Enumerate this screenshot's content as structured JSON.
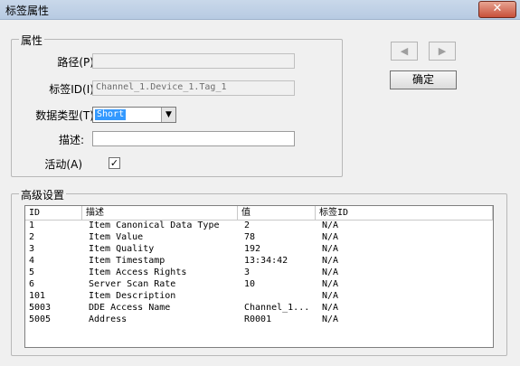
{
  "window": {
    "title": "标签属性",
    "close_glyph": "✕"
  },
  "properties": {
    "group_label": "属性",
    "path": {
      "label": "路径(P):",
      "value": ""
    },
    "tag_id": {
      "label": "标签ID(I):",
      "value": "Channel_1.Device_1.Tag_1"
    },
    "data_type": {
      "label": "数据类型(T):",
      "value": "Short"
    },
    "description": {
      "label": "描述:",
      "value": ""
    },
    "active": {
      "label": "活动(A)",
      "checked": true,
      "glyph": "✓"
    }
  },
  "nav": {
    "prev_glyph": "◀",
    "next_glyph": "▶"
  },
  "ok_button": {
    "label": "确定"
  },
  "advanced": {
    "group_label": "高级设置",
    "columns": [
      "ID",
      "描述",
      "值",
      "标签ID"
    ],
    "rows": [
      {
        "id": "1",
        "desc": "Item Canonical Data Type",
        "value": "2",
        "tag": "N/A"
      },
      {
        "id": "2",
        "desc": "Item Value",
        "value": "78",
        "tag": "N/A"
      },
      {
        "id": "3",
        "desc": "Item Quality",
        "value": "192",
        "tag": "N/A"
      },
      {
        "id": "4",
        "desc": "Item Timestamp",
        "value": "13:34:42",
        "tag": "N/A"
      },
      {
        "id": "5",
        "desc": "Item Access Rights",
        "value": "3",
        "tag": "N/A"
      },
      {
        "id": "6",
        "desc": "Server Scan Rate",
        "value": "10",
        "tag": "N/A"
      },
      {
        "id": "101",
        "desc": "Item Description",
        "value": "",
        "tag": "N/A"
      },
      {
        "id": "5003",
        "desc": "DDE Access Name",
        "value": "Channel_1...",
        "tag": "N/A"
      },
      {
        "id": "5005",
        "desc": "Address",
        "value": "R0001",
        "tag": "N/A"
      }
    ]
  }
}
